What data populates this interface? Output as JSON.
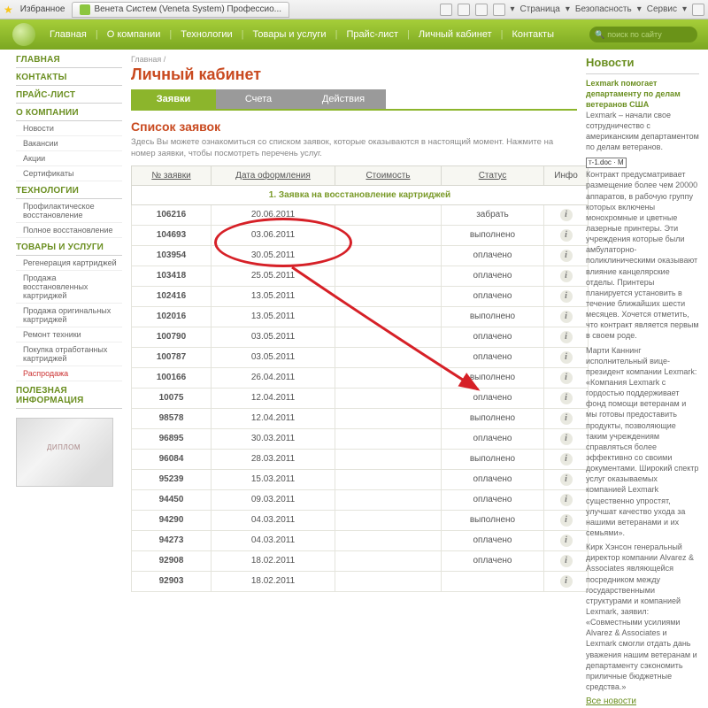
{
  "ie": {
    "fav": "Избранное",
    "tab_title": "Венета Систем (Veneta System) Профессио...",
    "menu": {
      "page": "Страница",
      "safety": "Безопасность",
      "service": "Сервис"
    }
  },
  "nav": {
    "items": [
      "Главная",
      "О компании",
      "Технологии",
      "Товары и услуги",
      "Прайс-лист",
      "Личный кабинет",
      "Контакты"
    ],
    "search_placeholder": "поиск по сайту"
  },
  "sidebar": {
    "main": "ГЛАВНАЯ",
    "contacts": "КОНТАКТЫ",
    "price": "ПРАЙС-ЛИСТ",
    "about": "О КОМПАНИИ",
    "about_items": [
      "Новости",
      "Вакансии",
      "Акции",
      "Сертификаты"
    ],
    "tech": "ТЕХНОЛОГИИ",
    "tech_items": [
      "Профилактическое восстановление",
      "Полное восстановление"
    ],
    "goods": "ТОВАРЫ И УСЛУГИ",
    "goods_items": [
      "Регенерация картриджей",
      "Продажа восстановленных картриджей",
      "Продажа оригинальных картриджей",
      "Ремонт техники",
      "Покупка отработанных картриджей",
      "Распродажа"
    ],
    "useful": "ПОЛЕЗНАЯ ИНФОРМАЦИЯ"
  },
  "main": {
    "crumb": "Главная /",
    "h1": "Личный кабинет",
    "tabs": [
      "Заявки",
      "Счета",
      "Действия"
    ],
    "h2": "Список заявок",
    "hint": "Здесь Вы можете ознакомиться со списком заявок, которые оказываются в настоящий момент. Нажмите на номер заявки, чтобы посмотреть перечень услуг.",
    "cols": [
      "№ заявки",
      "Дата оформления",
      "Стоимость",
      "Статус",
      "Инфо"
    ],
    "section": "1. Заявка на восстановление картриджей",
    "rows": [
      {
        "n": "106216",
        "d": "20.06.2011",
        "c": "",
        "s": "забрать"
      },
      {
        "n": "104693",
        "d": "03.06.2011",
        "c": "",
        "s": "выполнено"
      },
      {
        "n": "103954",
        "d": "30.05.2011",
        "c": "",
        "s": "оплачено"
      },
      {
        "n": "103418",
        "d": "25.05.2011",
        "c": "",
        "s": "оплачено"
      },
      {
        "n": "102416",
        "d": "13.05.2011",
        "c": "",
        "s": "оплачено"
      },
      {
        "n": "102016",
        "d": "13.05.2011",
        "c": "",
        "s": "выполнено"
      },
      {
        "n": "100790",
        "d": "03.05.2011",
        "c": "",
        "s": "оплачено"
      },
      {
        "n": "100787",
        "d": "03.05.2011",
        "c": "",
        "s": "оплачено"
      },
      {
        "n": "100166",
        "d": "26.04.2011",
        "c": "",
        "s": "выполнено"
      },
      {
        "n": "10075",
        "d": "12.04.2011",
        "c": "",
        "s": "оплачено"
      },
      {
        "n": "98578",
        "d": "12.04.2011",
        "c": "",
        "s": "выполнено"
      },
      {
        "n": "96895",
        "d": "30.03.2011",
        "c": "",
        "s": "оплачено"
      },
      {
        "n": "96084",
        "d": "28.03.2011",
        "c": "",
        "s": "выполнено"
      },
      {
        "n": "95239",
        "d": "15.03.2011",
        "c": "",
        "s": "оплачено"
      },
      {
        "n": "94450",
        "d": "09.03.2011",
        "c": "",
        "s": "оплачено"
      },
      {
        "n": "94290",
        "d": "04.03.2011",
        "c": "",
        "s": "выполнено"
      },
      {
        "n": "94273",
        "d": "04.03.2011",
        "c": "",
        "s": "оплачено"
      },
      {
        "n": "92908",
        "d": "18.02.2011",
        "c": "",
        "s": "оплачено"
      },
      {
        "n": "92903",
        "d": "18.02.2011",
        "c": "",
        "s": ""
      }
    ]
  },
  "news": {
    "title": "Новости",
    "item1_h": "Lexmark помогает департаменту по делам ветеранов США",
    "item1_body": "Lexmark – начали свое сотрудничество с американским департаментом по делам ветеранов.",
    "doc": "т-1.doc · М",
    "body2": "Контракт предусматривает размещение более чем 20000 аппаратов, в рабочую группу которых включены монохромные и цветные лазерные принтеры. Эти учреждения которые были амбулаторно-поликлиническими оказывают влияние канцелярские отделы. Принтеры планируется установить в течение ближайших шести месяцев. Хочется отметить, что контракт является первым в своем роде.",
    "body3": "Марти Каннинг исполнительный вице-президент компании Lexmark: «Компания Lexmark с гордостью поддерживает фонд помощи ветеранам и мы готовы предоставить продукты, позволяющие таким учреждениям справляться более эффективно со своими документами. Широкий спектр услуг оказываемых компанией Lexmark существенно упростят, улучшат качество ухода за нашими ветеранами и их семьями».",
    "body4": "Кирк Хэнсон генеральный директор компании Alvarez & Associates являющейся посредником между государственными структурами и компанией Lexmark, заявил: «Совместными усилиями Alvarez & Associates и Lexmark смогли отдать дань уважения нашим ветеранам и департаменту сэкономить приличные бюджетные средства.»",
    "all": "Все новости"
  }
}
